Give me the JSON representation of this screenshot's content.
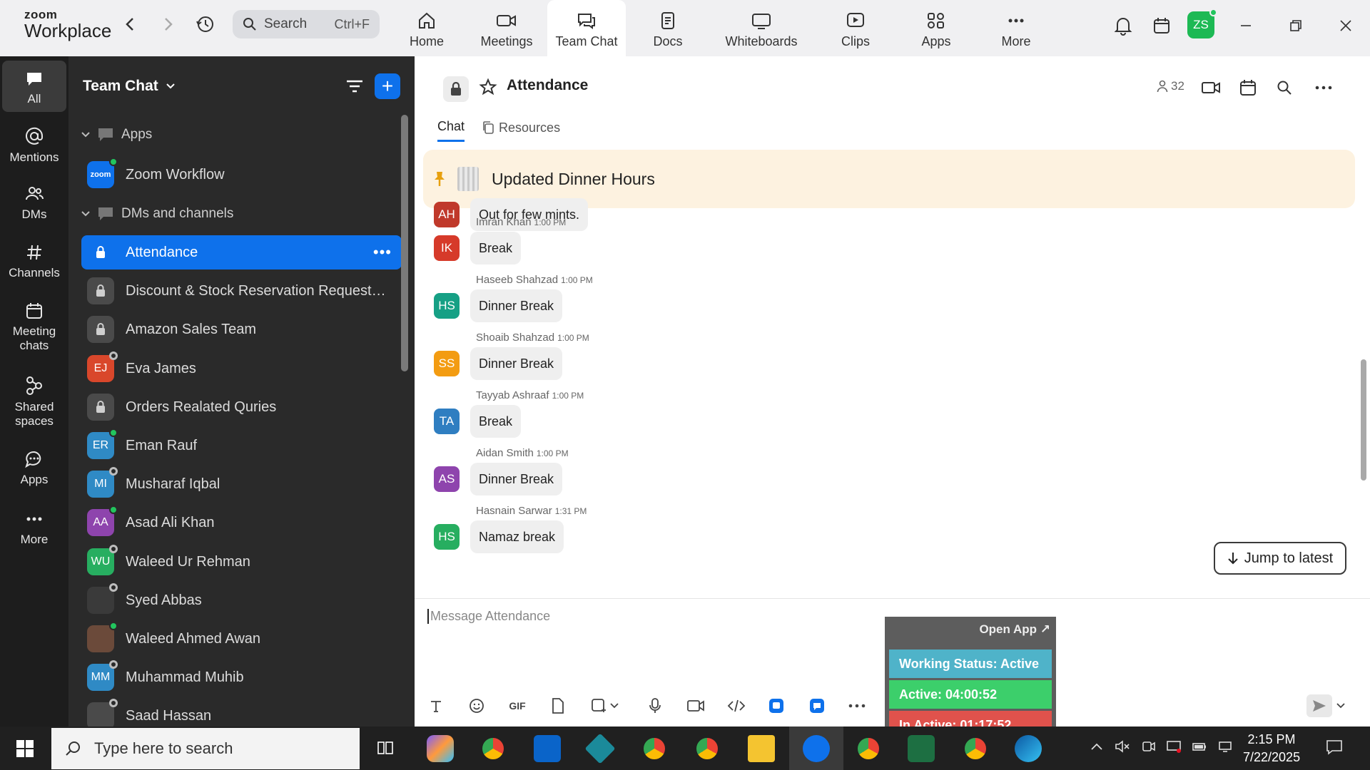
{
  "app": {
    "brand_top": "zoom",
    "brand_bottom": "Workplace"
  },
  "search": {
    "placeholder": "Search",
    "shortcut": "Ctrl+F"
  },
  "nav_tabs": [
    {
      "label": "Home",
      "icon": "home-icon"
    },
    {
      "label": "Meetings",
      "icon": "video-camera-icon"
    },
    {
      "label": "Team Chat",
      "icon": "chat-icon"
    },
    {
      "label": "Docs",
      "icon": "doc-icon"
    },
    {
      "label": "Whiteboards",
      "icon": "whiteboard-icon"
    },
    {
      "label": "Clips",
      "icon": "clips-icon"
    },
    {
      "label": "Apps",
      "icon": "apps-icon"
    },
    {
      "label": "More",
      "icon": "more-icon"
    }
  ],
  "active_tab": "Team Chat",
  "user": {
    "initials": "ZS",
    "color": "#1db954"
  },
  "rail": [
    {
      "label": "All"
    },
    {
      "label": "Mentions"
    },
    {
      "label": "DMs"
    },
    {
      "label": "Channels"
    },
    {
      "label": "Meeting chats"
    },
    {
      "label": "Shared spaces"
    },
    {
      "label": "Apps"
    },
    {
      "label": "More"
    }
  ],
  "sidebar": {
    "title": "Team Chat",
    "sections": {
      "apps": "Apps",
      "dms": "DMs and channels"
    },
    "app_item": {
      "label": "Zoom Workflow",
      "icon_text": "zoom"
    },
    "items": [
      {
        "label": "Attendance",
        "type": "lock",
        "active": true
      },
      {
        "label": "Discount & Stock Reservation Requests O...",
        "type": "lock"
      },
      {
        "label": "Amazon Sales Team",
        "type": "lock"
      },
      {
        "label": "Eva James",
        "type": "avatar",
        "initials": "EJ",
        "color": "#d9472b",
        "status": "away"
      },
      {
        "label": "Orders Realated Quries",
        "type": "lock"
      },
      {
        "label": "Eman Rauf",
        "type": "avatar",
        "initials": "ER",
        "color": "#2f8ac5",
        "status": "online"
      },
      {
        "label": "Musharaf Iqbal",
        "type": "avatar",
        "initials": "MI",
        "color": "#2f8ac5",
        "status": "away"
      },
      {
        "label": "Asad Ali Khan",
        "type": "avatar",
        "initials": "AA",
        "color": "#8e44ad",
        "status": "online"
      },
      {
        "label": "Waleed Ur Rehman",
        "type": "avatar",
        "initials": "WU",
        "color": "#27ae60",
        "status": "away"
      },
      {
        "label": "Syed Abbas",
        "type": "photo",
        "initials": "",
        "color": "#3a3a3a",
        "status": "away"
      },
      {
        "label": "Waleed Ahmed Awan",
        "type": "photo",
        "initials": "",
        "color": "#6b4a3a",
        "status": "online"
      },
      {
        "label": "Muhammad Muhib",
        "type": "avatar",
        "initials": "MM",
        "color": "#2f8ac5",
        "status": "away"
      },
      {
        "label": "Saad Hassan",
        "type": "photo",
        "initials": "",
        "color": "#4a4a4a",
        "status": "away"
      }
    ]
  },
  "channel": {
    "name": "Attendance",
    "members": "32",
    "subtabs": [
      "Chat",
      "Resources"
    ],
    "pinned": "Updated Dinner Hours"
  },
  "messages": [
    {
      "initials": "AH",
      "color": "#c0392b",
      "sender": "",
      "time": "",
      "text": "Out for few mints."
    },
    {
      "initials": "IK",
      "color": "#d63a2a",
      "sender": "Imran Khan",
      "time": "1:00 PM",
      "text": "Break"
    },
    {
      "initials": "HS",
      "color": "#16a085",
      "sender": "Haseeb Shahzad",
      "time": "1:00 PM",
      "text": "Dinner Break"
    },
    {
      "initials": "SS",
      "color": "#f39c12",
      "sender": "Shoaib Shahzad",
      "time": "1:00 PM",
      "text": "Dinner Break"
    },
    {
      "initials": "TA",
      "color": "#2f7ec1",
      "sender": "Tayyab Ashraaf",
      "time": "1:00 PM",
      "text": "Break"
    },
    {
      "initials": "AS",
      "color": "#8e44ad",
      "sender": "Aidan Smith",
      "time": "1:00 PM",
      "text": "Dinner Break"
    },
    {
      "initials": "HS",
      "color": "#27ae60",
      "sender": "Hasnain Sarwar",
      "time": "1:31 PM",
      "text": "Namaz break"
    }
  ],
  "jump_label": "Jump to latest",
  "compose": {
    "placeholder": "Message Attendance"
  },
  "widget": {
    "open_app": "Open App ↗",
    "working": "Working Status: Active",
    "active": "Active: 04:00:52",
    "inactive": "In Active: 01:17:52",
    "colors": {
      "working": "#4fb3c9",
      "active": "#3ccf6b",
      "inactive": "#e0524c"
    }
  },
  "taskbar": {
    "search_placeholder": "Type here to search",
    "time": "2:15 PM",
    "date": "7/22/2025"
  }
}
